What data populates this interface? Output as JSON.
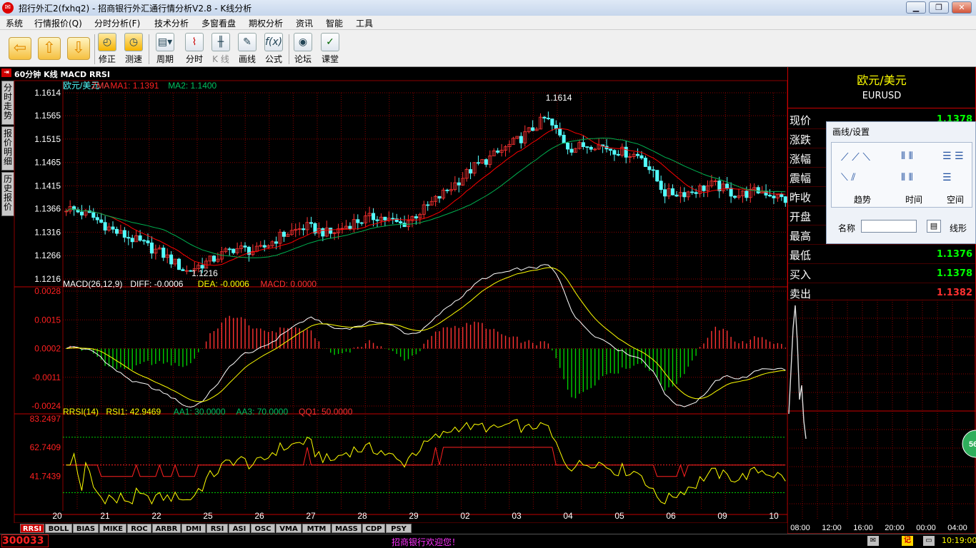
{
  "window": {
    "title": "招行外汇2(fxhq2) - 招商银行外汇通行情分析V2.8 - K线分析",
    "app_icon": "app-logo-icon",
    "buttons": [
      "minimize-icon",
      "restore-icon",
      "close-icon"
    ]
  },
  "menu": [
    "系统",
    "行情报价(Q)",
    "分时分析(F)",
    "技术分析",
    "多窗看盘",
    "期权分析",
    "资讯",
    "智能",
    "工具"
  ],
  "toolbar": {
    "nav": [
      "back-arrow-icon",
      "up-arrow-icon",
      "down-arrow-icon"
    ],
    "buttons": [
      "修正",
      "测速",
      "周期",
      "分时",
      "K 线",
      "画线",
      "公式",
      "论坛",
      "课堂"
    ]
  },
  "chart_header": "60分钟 K线 MACD RRSI",
  "side_tabs": [
    "分时走势",
    "报价明细",
    "历史报价"
  ],
  "colors": {
    "up": "#ff3232",
    "down": "#54ffff",
    "ma1": "#ff0000",
    "ma2": "#00b050",
    "diff": "#ffffff",
    "dea": "#ffff00",
    "grid": "#8b0000",
    "label_red": "#ff2020",
    "label_green": "#00d000",
    "label_yellow": "#ffff00",
    "panel_bg": "#000000"
  },
  "chart_data": [
    {
      "type": "candlestick",
      "title": "欧元/美元",
      "legend": [
        {
          "text": "欧元/美元",
          "color": "#54ffff"
        },
        {
          "text": "ZMA",
          "color": "#ff4040"
        },
        {
          "text": "MA1: 1.1391",
          "color": "#ff2020"
        },
        {
          "text": "MA2: 1.1400",
          "color": "#00c060"
        }
      ],
      "yticks": [
        1.1614,
        1.1565,
        1.1515,
        1.1465,
        1.1415,
        1.1366,
        1.1316,
        1.1266,
        1.1216
      ],
      "ylim": [
        1.1216,
        1.1614
      ],
      "high_label": "1.1614",
      "low_label": "1.1216",
      "x": [
        "20",
        "21",
        "22",
        "25",
        "26",
        "27",
        "28",
        "29",
        "02",
        "03",
        "04",
        "05",
        "06",
        "09",
        "10"
      ],
      "close_anchors": [
        1.1368,
        1.1352,
        1.1318,
        1.1296,
        1.127,
        1.1232,
        1.1255,
        1.1282,
        1.1275,
        1.131,
        1.1328,
        1.1312,
        1.1338,
        1.135,
        1.1332,
        1.1368,
        1.141,
        1.1455,
        1.1485,
        1.1518,
        1.156,
        1.1495,
        1.1505,
        1.149,
        1.1478,
        1.1398,
        1.1402,
        1.1418,
        1.1395,
        1.1405,
        1.1385
      ]
    },
    {
      "type": "line",
      "title": "MACD(26,12,9)",
      "legend": [
        {
          "text": "MACD(26,12,9)",
          "color": "#ffffff"
        },
        {
          "text": "DIFF: -0.0006",
          "color": "#ffffff"
        },
        {
          "text": "DEA: -0.0006",
          "color": "#ffff00"
        },
        {
          "text": "MACD: 0.0000",
          "color": "#ff3030"
        }
      ],
      "yticks": [
        0.0028,
        0.0015,
        0.0002,
        -0.0011,
        -0.0024
      ],
      "ylim": [
        -0.0024,
        0.0028
      ]
    },
    {
      "type": "line",
      "title": "RRSI(14)",
      "legend": [
        {
          "text": "RRSI(14)",
          "color": "#ffff00"
        },
        {
          "text": "RSI1: 42.9469",
          "color": "#ffff00"
        },
        {
          "text": "AA1: 30.0000",
          "color": "#00c060"
        },
        {
          "text": "AA3: 70.0000",
          "color": "#00c060"
        },
        {
          "text": "QQ1: 50.0000",
          "color": "#ff3030"
        }
      ],
      "yticks": [
        83.2497,
        62.7409,
        41.7439
      ],
      "ylim": [
        20,
        83.2497
      ],
      "levels": [
        30,
        50,
        70
      ]
    }
  ],
  "quote": {
    "name": "欧元/美元",
    "code": "EURUSD",
    "rows": [
      {
        "label": "现价",
        "value": "1.1378",
        "color": "#00ff00"
      },
      {
        "label": "涨跌",
        "value": "",
        "color": "#00ff00"
      },
      {
        "label": "涨幅",
        "value": "",
        "color": "#00ff00"
      },
      {
        "label": "震幅",
        "value": "",
        "color": "#ffffff"
      },
      {
        "label": "昨收",
        "value": "",
        "color": "#ffffff"
      },
      {
        "label": "开盘",
        "value": "",
        "color": "#ffffff"
      },
      {
        "label": "最高",
        "value": "",
        "color": "#ffffff"
      },
      {
        "label": "最低",
        "value": "1.1376",
        "color": "#00ff00"
      },
      {
        "label": "买入",
        "value": "1.1378",
        "color": "#00ff00"
      },
      {
        "label": "卖出",
        "value": "1.1382",
        "color": "#ff3030"
      }
    ]
  },
  "draw_panel": {
    "title": "画线/设置",
    "groups": [
      "趋势",
      "时间",
      "空间"
    ],
    "name_label": "名称",
    "shape_label": "线形"
  },
  "mini_chart": {
    "times": [
      "08:00",
      "12:00",
      "16:00",
      "20:00",
      "00:00",
      "04:00"
    ],
    "badge": "56"
  },
  "bottom_tabs": [
    "RRSI",
    "BOLL",
    "BIAS",
    "MIKE",
    "ROC",
    "ARBR",
    "DMI",
    "RSI",
    "ASI",
    "OSC",
    "VMA",
    "MTM",
    "MASS",
    "CDP",
    "PSY"
  ],
  "status": {
    "code": "300033",
    "ticker": "招商银行欢迎您！",
    "time": "10:19:00",
    "icons": [
      "mail-icon",
      "notebook-icon"
    ]
  }
}
